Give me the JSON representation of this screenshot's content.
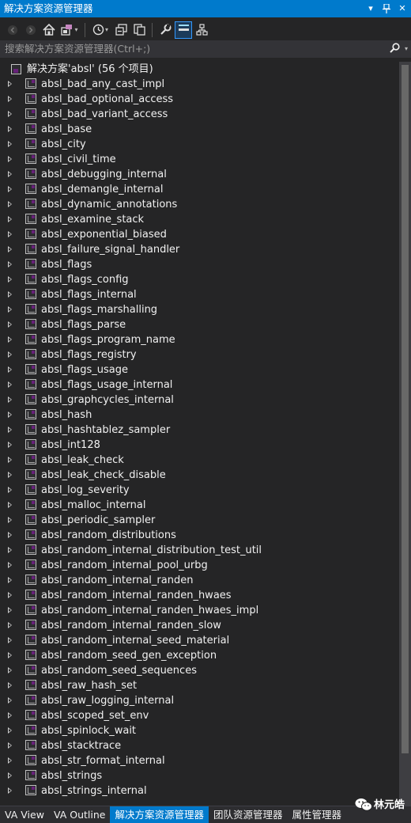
{
  "window": {
    "title": "解决方案资源管理器",
    "pin_icon": "dropdown-arrow",
    "close_icon": "close"
  },
  "toolbar": {
    "tools": [
      "back-icon",
      "forward-icon",
      "home-icon",
      "switch-views-icon",
      "history-icon",
      "collapse-all-icon",
      "show-all-files-icon",
      "properties-icon",
      "preview-icon",
      "class-diagram-icon"
    ]
  },
  "search": {
    "placeholder": "搜索解决方案资源管理器(Ctrl+;)"
  },
  "tree": {
    "root_label": "解决方案'absl' (56 个项目)",
    "projects": [
      "absl_bad_any_cast_impl",
      "absl_bad_optional_access",
      "absl_bad_variant_access",
      "absl_base",
      "absl_city",
      "absl_civil_time",
      "absl_debugging_internal",
      "absl_demangle_internal",
      "absl_dynamic_annotations",
      "absl_examine_stack",
      "absl_exponential_biased",
      "absl_failure_signal_handler",
      "absl_flags",
      "absl_flags_config",
      "absl_flags_internal",
      "absl_flags_marshalling",
      "absl_flags_parse",
      "absl_flags_program_name",
      "absl_flags_registry",
      "absl_flags_usage",
      "absl_flags_usage_internal",
      "absl_graphcycles_internal",
      "absl_hash",
      "absl_hashtablez_sampler",
      "absl_int128",
      "absl_leak_check",
      "absl_leak_check_disable",
      "absl_log_severity",
      "absl_malloc_internal",
      "absl_periodic_sampler",
      "absl_random_distributions",
      "absl_random_internal_distribution_test_util",
      "absl_random_internal_pool_urbg",
      "absl_random_internal_randen",
      "absl_random_internal_randen_hwaes",
      "absl_random_internal_randen_hwaes_impl",
      "absl_random_internal_randen_slow",
      "absl_random_internal_seed_material",
      "absl_random_seed_gen_exception",
      "absl_random_seed_sequences",
      "absl_raw_hash_set",
      "absl_raw_logging_internal",
      "absl_scoped_set_env",
      "absl_spinlock_wait",
      "absl_stacktrace",
      "absl_str_format_internal",
      "absl_strings",
      "absl_strings_internal"
    ]
  },
  "bottom_tabs": [
    {
      "label": "VA View",
      "active": false
    },
    {
      "label": "VA Outline",
      "active": false
    },
    {
      "label": "解决方案资源管理器",
      "active": true
    },
    {
      "label": "团队资源管理器",
      "active": false
    },
    {
      "label": "属性管理器",
      "active": false
    }
  ],
  "watermark": {
    "text": "林元皓"
  },
  "colors": {
    "accent": "#007acc",
    "background": "#252526"
  }
}
